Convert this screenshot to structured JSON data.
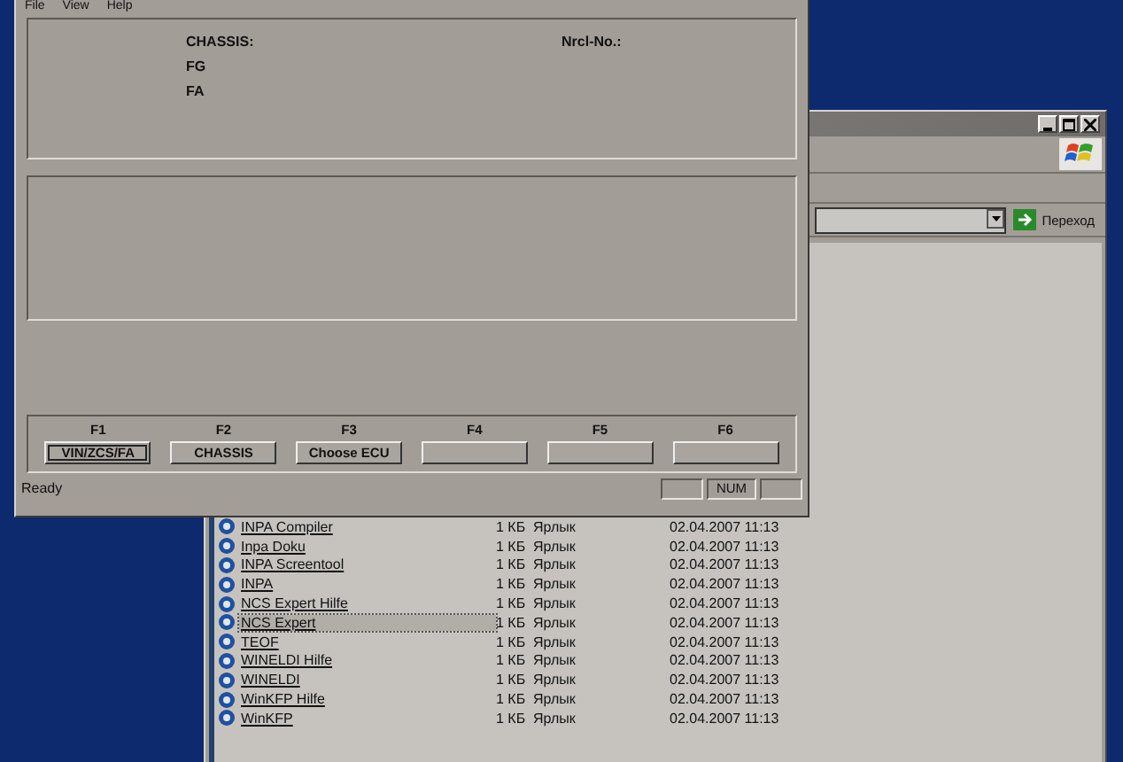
{
  "explorer_window": {
    "go_button": "Переход",
    "files": [
      {
        "name": "INPA Compiler",
        "size": "1 КБ",
        "type": "Ярлык",
        "modified": "02.04.2007 11:13",
        "selected": false
      },
      {
        "name": "Inpa Doku",
        "size": "1 КБ",
        "type": "Ярлык",
        "modified": "02.04.2007 11:13",
        "selected": false
      },
      {
        "name": "INPA Screentool",
        "size": "1 КБ",
        "type": "Ярлык",
        "modified": "02.04.2007 11:13",
        "selected": false
      },
      {
        "name": "INPA",
        "size": "1 КБ",
        "type": "Ярлык",
        "modified": "02.04.2007 11:13",
        "selected": false
      },
      {
        "name": "NCS Expert Hilfe",
        "size": "1 КБ",
        "type": "Ярлык",
        "modified": "02.04.2007 11:13",
        "selected": false
      },
      {
        "name": "NCS Expert",
        "size": "1 КБ",
        "type": "Ярлык",
        "modified": "02.04.2007 11:13",
        "selected": true
      },
      {
        "name": "TEOF",
        "size": "1 КБ",
        "type": "Ярлык",
        "modified": "02.04.2007 11:13",
        "selected": false
      },
      {
        "name": "WINELDI Hilfe",
        "size": "1 КБ",
        "type": "Ярлык",
        "modified": "02.04.2007 11:13",
        "selected": false
      },
      {
        "name": "WINELDI",
        "size": "1 КБ",
        "type": "Ярлык",
        "modified": "02.04.2007 11:13",
        "selected": false
      },
      {
        "name": "WinKFP Hilfe",
        "size": "1 КБ",
        "type": "Ярлык",
        "modified": "02.04.2007 11:13",
        "selected": false
      },
      {
        "name": "WinKFP",
        "size": "1 КБ",
        "type": "Ярлык",
        "modified": "02.04.2007 11:13",
        "selected": false
      }
    ]
  },
  "main_window": {
    "menu": [
      "File",
      "View",
      "Help"
    ],
    "info_panel": {
      "chassis_label": "CHASSIS:",
      "fg_label": "FG",
      "fa_label": "FA",
      "nrcl_label": "Nrcl-No.:"
    },
    "function_keys": [
      {
        "key": "F1",
        "button": "VIN/ZCS/FA"
      },
      {
        "key": "F2",
        "button": "CHASSIS"
      },
      {
        "key": "F3",
        "button": "Choose ECU"
      },
      {
        "key": "F4"
      },
      {
        "key": "F5"
      },
      {
        "key": "F6"
      }
    ],
    "status_bar": {
      "text": "Ready",
      "indicator": "NUM"
    }
  }
}
